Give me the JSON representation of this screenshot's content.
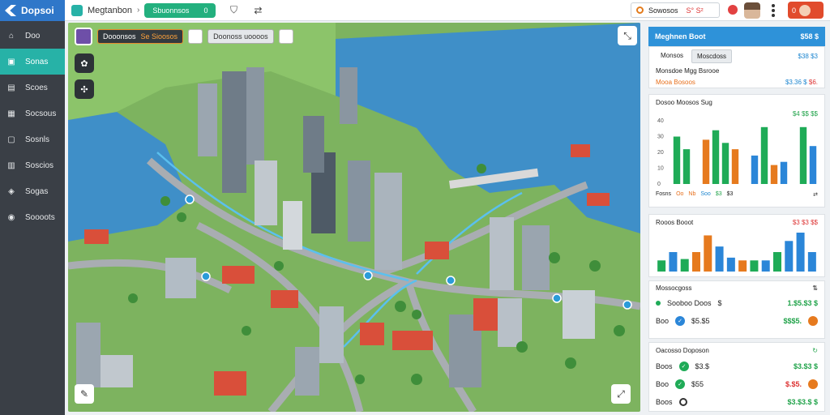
{
  "app": {
    "logo_text": "Dopsoi"
  },
  "sidebar": {
    "items": [
      {
        "label": "Doo",
        "icon": "home-icon"
      },
      {
        "label": "Sonas",
        "icon": "layers-icon"
      },
      {
        "label": "Scoes",
        "icon": "doc-icon"
      },
      {
        "label": "Socsous",
        "icon": "chart-icon"
      },
      {
        "label": "Sosnls",
        "icon": "folder-icon"
      },
      {
        "label": "Soscios",
        "icon": "grid-icon"
      },
      {
        "label": "Sogas",
        "icon": "tag-icon"
      },
      {
        "label": "Soooots",
        "icon": "pin-icon"
      }
    ],
    "active_index": 1
  },
  "topbar": {
    "brand": "Megtanbon",
    "action_button": "Sbuonnsos",
    "action_suffix": "0",
    "search_value": "Sowosos",
    "search_extra": "S° S²",
    "profile_label": "0"
  },
  "map": {
    "toolbar_chip_1": "Dooonsos",
    "toolbar_chip_1_accent": "Se Sioosos",
    "toolbar_chip_2": "Doonoss uoooos"
  },
  "panel": {
    "title": "Meghnen Boot",
    "title_value": "$58 $",
    "tabs": [
      "Monsos",
      "Moscdoss"
    ],
    "tabs_value": "$38 $3",
    "line1_label": "Monsdoe Mgg Bsrooe",
    "line2_label": "Mooa Bosoos",
    "line2_value_a": "$3.36 $",
    "line2_value_b": "$6.",
    "chart1": {
      "title": "Dosoo Moosos Sug",
      "value": "$4 $$ $$",
      "legend": [
        "Fosns",
        "Oo",
        "Nb",
        "Soo",
        "$3",
        "$3"
      ]
    },
    "chart2": {
      "title": "Rooos Booot",
      "value": "$3 $3 $$"
    },
    "section_title": "Mossocgoss",
    "rows1": [
      {
        "label": "Sooboo Doos",
        "sub": "$",
        "value": "1.$5.$3 $"
      },
      {
        "label": "Boo",
        "sub": "$5.$5",
        "value": "$$$5."
      }
    ],
    "section2_title": "Oacosso Doposon",
    "rows2": [
      {
        "label": "Boos",
        "sub": "$3.$",
        "value": "$3.$3 $"
      },
      {
        "label": "Boo",
        "sub": "$55",
        "value": "$.$5."
      },
      {
        "label": "Boos",
        "sub": "",
        "value": "$3.$3.$ $"
      }
    ]
  },
  "chart_data": [
    {
      "type": "bar",
      "ylim": [
        0,
        40
      ],
      "yticks": [
        "40",
        "30",
        "20",
        "10",
        "0"
      ],
      "series": [
        {
          "values": [
            32,
            26,
            0,
            0,
            0,
            0,
            0,
            0,
            36,
            0,
            0,
            0,
            0,
            0,
            0,
            0,
            0,
            36,
            0
          ]
        },
        {
          "values": [
            0,
            0,
            0,
            0,
            0,
            24,
            0,
            0,
            0,
            0,
            0,
            32,
            0,
            0,
            0,
            0,
            0,
            0,
            0
          ]
        }
      ],
      "bars": [
        {
          "v": 30,
          "c": "#1fab57"
        },
        {
          "v": 22,
          "c": "#1fab57"
        },
        {
          "v": 0,
          "c": "none"
        },
        {
          "v": 28,
          "c": "#e67a1e"
        },
        {
          "v": 34,
          "c": "#1fab57"
        },
        {
          "v": 26,
          "c": "#1fab57"
        },
        {
          "v": 22,
          "c": "#e67a1e"
        },
        {
          "v": 0,
          "c": "none"
        },
        {
          "v": 18,
          "c": "#2b86d8"
        },
        {
          "v": 36,
          "c": "#1fab57"
        },
        {
          "v": 12,
          "c": "#e67a1e"
        },
        {
          "v": 14,
          "c": "#2b86d8"
        },
        {
          "v": 0,
          "c": "none"
        },
        {
          "v": 36,
          "c": "#1fab57"
        },
        {
          "v": 24,
          "c": "#2b86d8"
        }
      ]
    },
    {
      "type": "bar",
      "bars": [
        {
          "v": 8,
          "c": "#1fab57"
        },
        {
          "v": 14,
          "c": "#2b86d8"
        },
        {
          "v": 9,
          "c": "#1fab57"
        },
        {
          "v": 14,
          "c": "#e67a1e"
        },
        {
          "v": 26,
          "c": "#e67a1e"
        },
        {
          "v": 18,
          "c": "#2b86d8"
        },
        {
          "v": 10,
          "c": "#2b86d8"
        },
        {
          "v": 8,
          "c": "#e67a1e"
        },
        {
          "v": 8,
          "c": "#1fab57"
        },
        {
          "v": 8,
          "c": "#2b86d8"
        },
        {
          "v": 14,
          "c": "#1fab57"
        },
        {
          "v": 22,
          "c": "#2b86d8"
        },
        {
          "v": 28,
          "c": "#2b86d8"
        },
        {
          "v": 14,
          "c": "#2b86d8"
        }
      ]
    }
  ]
}
